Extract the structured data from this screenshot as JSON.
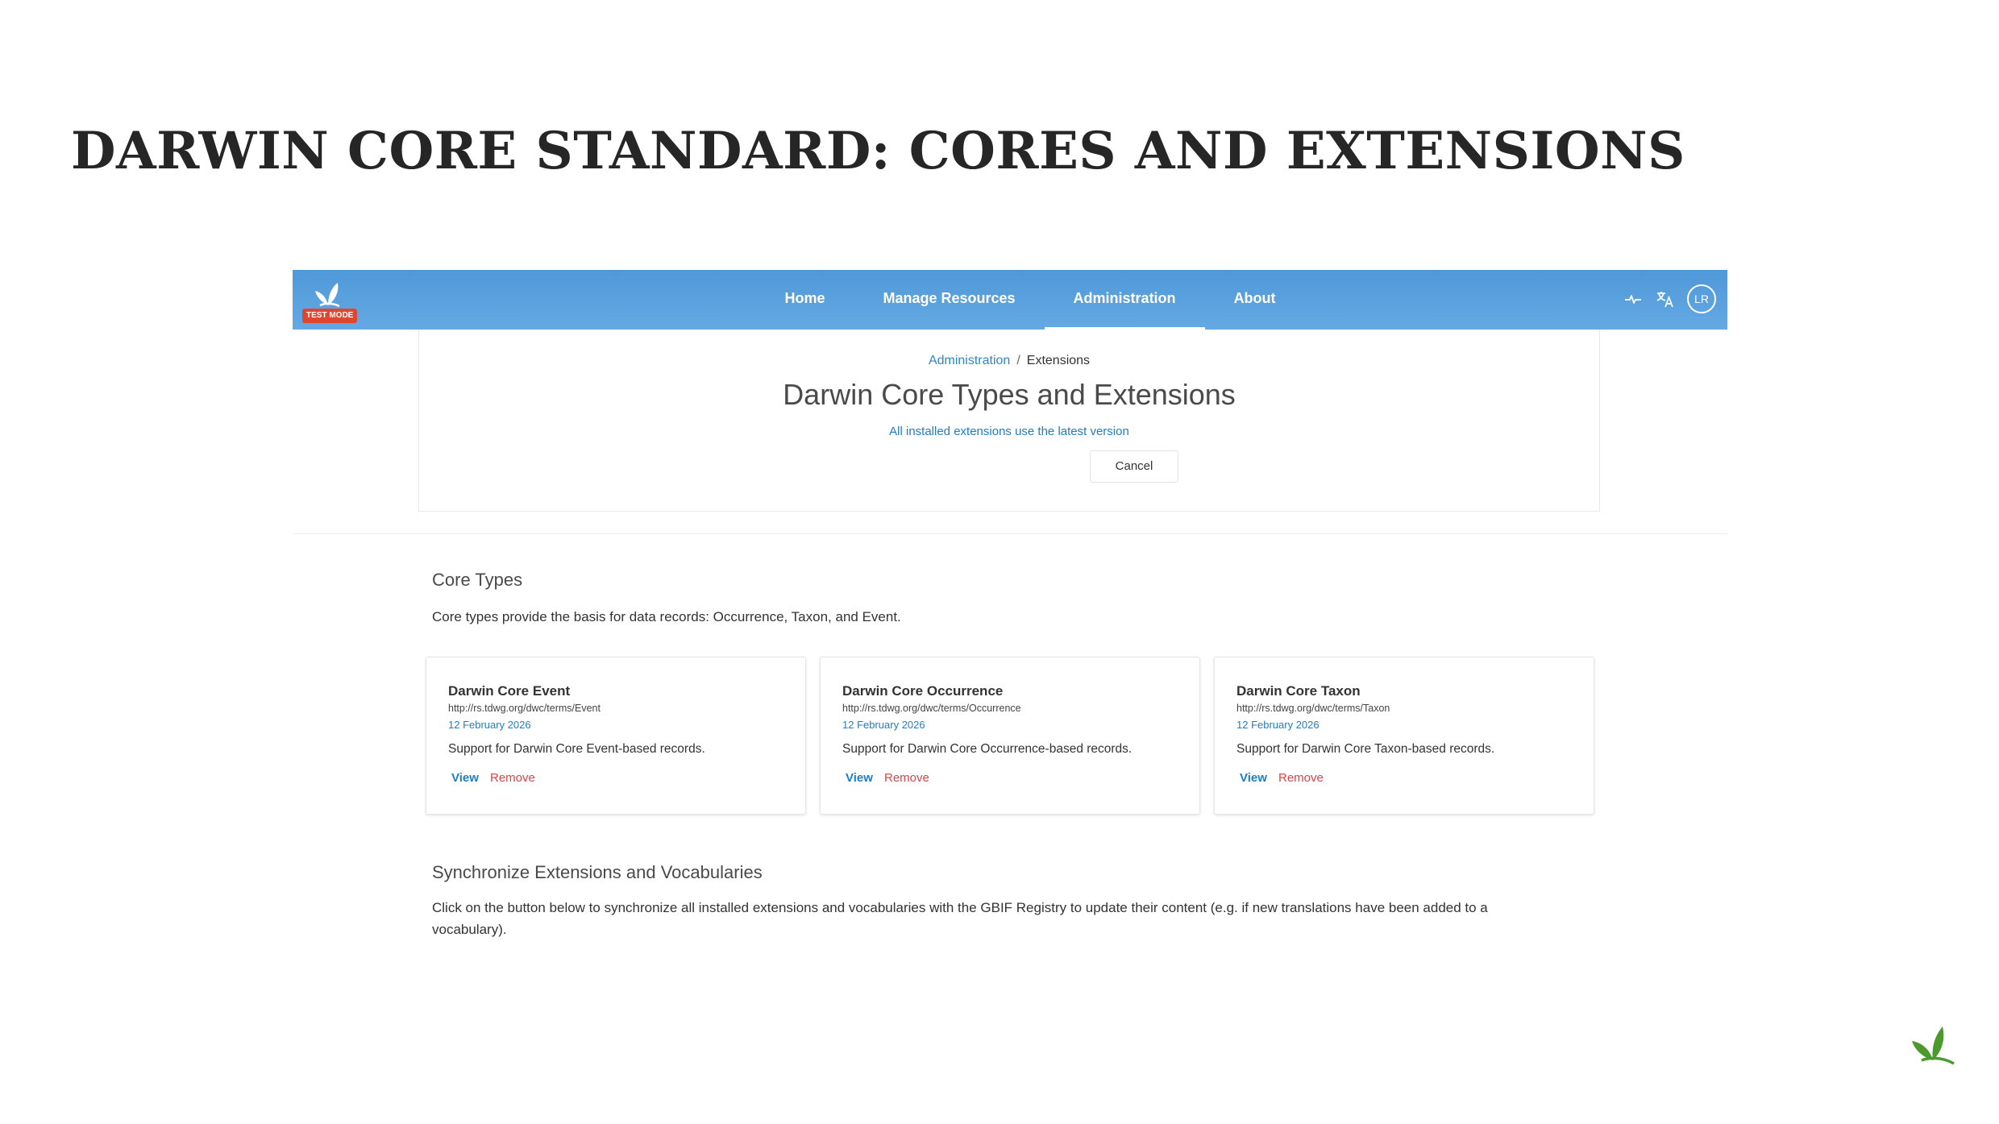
{
  "slide": {
    "title": "DARWIN CORE STANDARD: CORES AND EXTENSIONS"
  },
  "navbar": {
    "badge": "TEST MODE",
    "items": [
      {
        "label": "Home",
        "active": false
      },
      {
        "label": "Manage Resources",
        "active": false
      },
      {
        "label": "Administration",
        "active": true
      },
      {
        "label": "About",
        "active": false
      }
    ],
    "icons": [
      "health-pulse-icon",
      "translate-icon"
    ],
    "avatar_initials": "LR",
    "color": "#5aa3e0"
  },
  "header": {
    "breadcrumb": {
      "parent": "Administration",
      "separator": "/",
      "current": "Extensions"
    },
    "title": "Darwin Core Types and Extensions",
    "notice": "All installed extensions use the latest version",
    "cancel_label": "Cancel"
  },
  "core_types": {
    "title": "Core Types",
    "description": "Core types provide the basis for data records: Occurrence, Taxon, and Event.",
    "cards": [
      {
        "title": "Darwin Core Event",
        "url": "http://rs.tdwg.org/dwc/terms/Event",
        "date": "12 February 2026",
        "description": "Support for Darwin Core Event-based records.",
        "view_label": "View",
        "remove_label": "Remove"
      },
      {
        "title": "Darwin Core Occurrence",
        "url": "http://rs.tdwg.org/dwc/terms/Occurrence",
        "date": "12 February 2026",
        "description": "Support for Darwin Core Occurrence-based records.",
        "view_label": "View",
        "remove_label": "Remove"
      },
      {
        "title": "Darwin Core Taxon",
        "url": "http://rs.tdwg.org/dwc/terms/Taxon",
        "date": "12 February 2026",
        "description": "Support for Darwin Core Taxon-based records.",
        "view_label": "View",
        "remove_label": "Remove"
      }
    ]
  },
  "sync": {
    "title": "Synchronize Extensions and Vocabularies",
    "description_line1": "Click on the button below to synchronize all installed extensions and vocabularies with the GBIF Registry to update their content (e.g. if new translations have been added to a",
    "description_line2": "vocabulary)."
  },
  "colors": {
    "link_blue": "#1f7ec3",
    "remove_red": "#d9434b",
    "badge_red": "#e0452f",
    "leaf_green": "#4a9a2e"
  }
}
